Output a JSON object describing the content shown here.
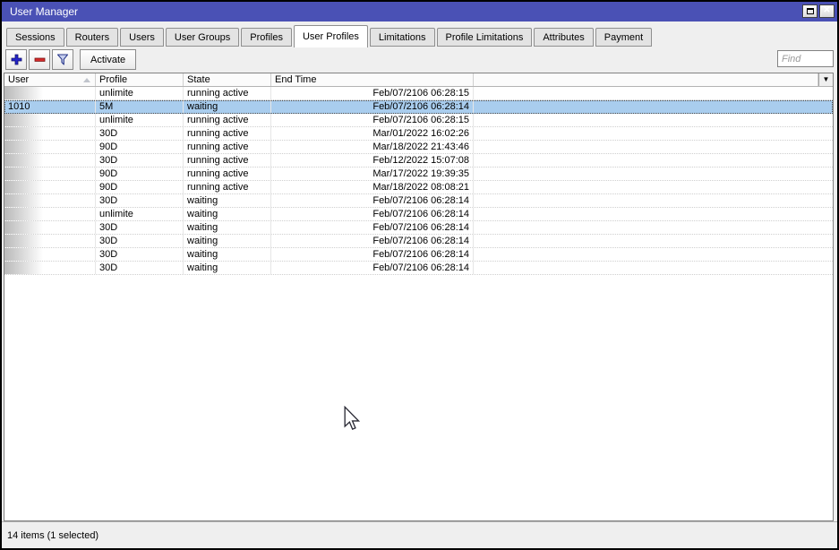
{
  "window": {
    "title": "User Manager"
  },
  "titlebar": {
    "maximize": "maximize",
    "close": "close"
  },
  "colors": {
    "titlebar": "#4a51b5",
    "selection": "#a9cdee",
    "add_icon": "#2424cc",
    "remove_icon": "#d42a2a",
    "filter_outline": "#2b3a8c",
    "filter_fill": "#c9d2f0"
  },
  "tabs": [
    {
      "label": "Sessions",
      "active": false
    },
    {
      "label": "Routers",
      "active": false
    },
    {
      "label": "Users",
      "active": false
    },
    {
      "label": "User Groups",
      "active": false
    },
    {
      "label": "Profiles",
      "active": false
    },
    {
      "label": "User Profiles",
      "active": true
    },
    {
      "label": "Limitations",
      "active": false
    },
    {
      "label": "Profile Limitations",
      "active": false
    },
    {
      "label": "Attributes",
      "active": false
    },
    {
      "label": "Payment",
      "active": false
    }
  ],
  "toolbar": {
    "activate_label": "Activate",
    "find_placeholder": "Find"
  },
  "table": {
    "columns": [
      "User",
      "Profile",
      "State",
      "End Time"
    ],
    "sort_column": "User",
    "rows": [
      {
        "user": "",
        "profile": "unlimite",
        "state": "running active",
        "end_time": "Feb/07/2106 06:28:15",
        "selected": false,
        "redacted": true
      },
      {
        "user": "1010",
        "profile": "5M",
        "state": "waiting",
        "end_time": "Feb/07/2106 06:28:14",
        "selected": true,
        "redacted": false
      },
      {
        "user": "",
        "profile": "unlimite",
        "state": "running active",
        "end_time": "Feb/07/2106 06:28:15",
        "selected": false,
        "redacted": true
      },
      {
        "user": "",
        "profile": "30D",
        "state": "running active",
        "end_time": "Mar/01/2022 16:02:26",
        "selected": false,
        "redacted": true
      },
      {
        "user": "",
        "profile": "90D",
        "state": "running active",
        "end_time": "Mar/18/2022 21:43:46",
        "selected": false,
        "redacted": true
      },
      {
        "user": "",
        "profile": "30D",
        "state": "running active",
        "end_time": "Feb/12/2022 15:07:08",
        "selected": false,
        "redacted": true
      },
      {
        "user": "",
        "profile": "90D",
        "state": "running active",
        "end_time": "Mar/17/2022 19:39:35",
        "selected": false,
        "redacted": true
      },
      {
        "user": "",
        "profile": "90D",
        "state": "running active",
        "end_time": "Mar/18/2022 08:08:21",
        "selected": false,
        "redacted": true
      },
      {
        "user": "",
        "profile": "30D",
        "state": "waiting",
        "end_time": "Feb/07/2106 06:28:14",
        "selected": false,
        "redacted": true
      },
      {
        "user": "",
        "profile": "unlimite",
        "state": "waiting",
        "end_time": "Feb/07/2106 06:28:14",
        "selected": false,
        "redacted": true
      },
      {
        "user": "",
        "profile": "30D",
        "state": "waiting",
        "end_time": "Feb/07/2106 06:28:14",
        "selected": false,
        "redacted": true
      },
      {
        "user": "",
        "profile": "30D",
        "state": "waiting",
        "end_time": "Feb/07/2106 06:28:14",
        "selected": false,
        "redacted": true
      },
      {
        "user": "",
        "profile": "30D",
        "state": "waiting",
        "end_time": "Feb/07/2106 06:28:14",
        "selected": false,
        "redacted": true
      },
      {
        "user": "",
        "profile": "30D",
        "state": "waiting",
        "end_time": "Feb/07/2106 06:28:14",
        "selected": false,
        "redacted": true
      }
    ]
  },
  "statusbar": {
    "text": "14 items (1 selected)"
  }
}
